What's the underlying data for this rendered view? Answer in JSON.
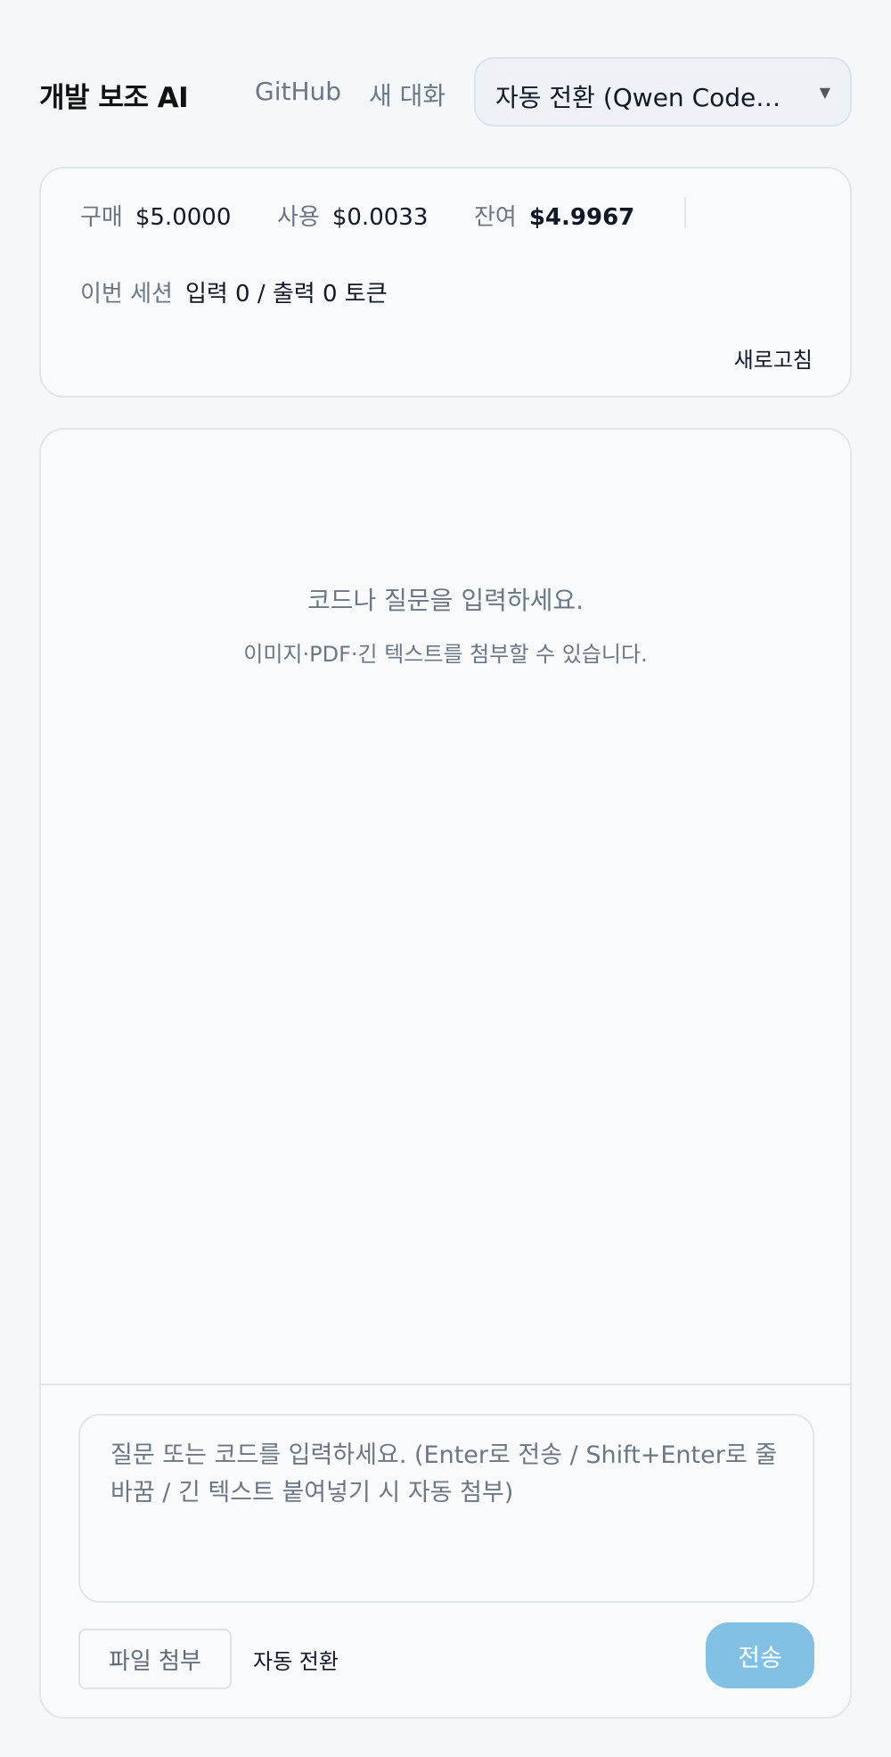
{
  "header": {
    "title": "개발 보조 AI",
    "github_label": "GitHub",
    "new_chat_label": "새 대화",
    "model_select": {
      "selected": "자동 전환 (Qwen Code…",
      "arrow_icon": "triangle-down-icon"
    }
  },
  "usage": {
    "purchased_label": "구매",
    "purchased_value": "$5.0000",
    "used_label": "사용",
    "used_value": "$0.0033",
    "balance_label": "잔여",
    "balance_value": "$4.9967",
    "session_label": "이번 세션",
    "session_value": "입력 0 / 출력 0 토큰",
    "refresh_label": "새로고침"
  },
  "chat": {
    "empty_line1": "코드나 질문을 입력하세요.",
    "empty_line2": "이미지·PDF·긴 텍스트를 첨부할 수 있습니다.",
    "input_placeholder": "질문 또는 코드를 입력하세요. (Enter로 전송 / Shift+Enter로 줄바꿈 / 긴 텍스트 붙여넣기 시 자동 첨부)",
    "attach_label": "파일 첨부",
    "mode_label": "자동 전환",
    "send_label": "전송"
  },
  "colors": {
    "background": "#f5f8fb",
    "muted_text": "#6b7785",
    "send_button": "#82c1e3"
  }
}
